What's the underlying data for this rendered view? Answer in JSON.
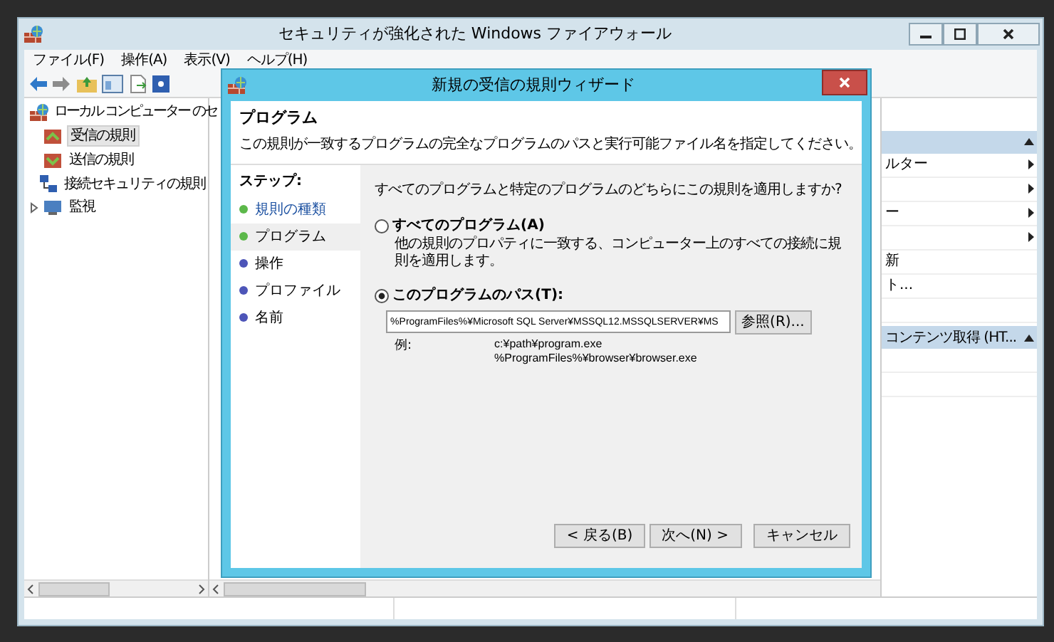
{
  "window": {
    "title": "セキュリティが強化された Windows ファイアウォール"
  },
  "menu": [
    "ファイル(F)",
    "操作(A)",
    "表示(V)",
    "ヘルプ(H)"
  ],
  "tree": {
    "root": "ローカル コンピューター のセ",
    "children": [
      {
        "label": "受信の規則",
        "selected": true
      },
      {
        "label": "送信の規則",
        "selected": false
      },
      {
        "label": "接続セキュリティの規則",
        "selected": false
      },
      {
        "label": "監視",
        "selected": false,
        "expanded": false
      }
    ]
  },
  "actions": {
    "sections": [
      {
        "expanded": true,
        "items": [
          {
            "label": "ルター",
            "submenu": true
          },
          {
            "submenu": true
          },
          {
            "label": "ー",
            "submenu": true
          },
          {
            "submenu": true
          },
          {
            "label": "新",
            "submenu": false
          },
          {
            "label": "ト...",
            "submenu": false
          }
        ]
      },
      {
        "title": "コンテンツ取得 (HT...",
        "expanded": true
      }
    ]
  },
  "dialog": {
    "title": "新規の受信の規則ウィザード",
    "heading": "プログラム",
    "description": "この規則が一致するプログラムの完全なプログラムのパスと実行可能ファイル名を指定してください。",
    "steps_title": "ステップ:",
    "steps": [
      {
        "label": "規則の種類",
        "selected": false,
        "completed": true
      },
      {
        "label": "プログラム",
        "selected": true,
        "completed": true
      },
      {
        "label": "操作",
        "selected": false,
        "completed": false
      },
      {
        "label": "プロファイル",
        "selected": false,
        "completed": false
      },
      {
        "label": "名前",
        "selected": false,
        "completed": false
      }
    ],
    "question": "すべてのプログラムと特定のプログラムのどちらにこの規則を適用しますか?",
    "options": [
      {
        "label": "すべてのプログラム(A)",
        "description": "他の規則のプロパティに一致する、コンピューター上のすべての接続に規則を適用します。",
        "selected": false
      },
      {
        "label": "このプログラムのパス(T):",
        "selected": true
      }
    ],
    "path": {
      "value": "%ProgramFiles%¥Microsoft SQL Server¥MSSQL12.MSSQLSERVER¥MS"
    },
    "browse_button": "参照(R)...",
    "example_label": "例:",
    "examples": [
      "c:¥path¥program.exe",
      "%ProgramFiles%¥browser¥browser.exe"
    ],
    "buttons": [
      "< 戻る(B)",
      "次へ(N) >",
      "キャンセル"
    ]
  }
}
